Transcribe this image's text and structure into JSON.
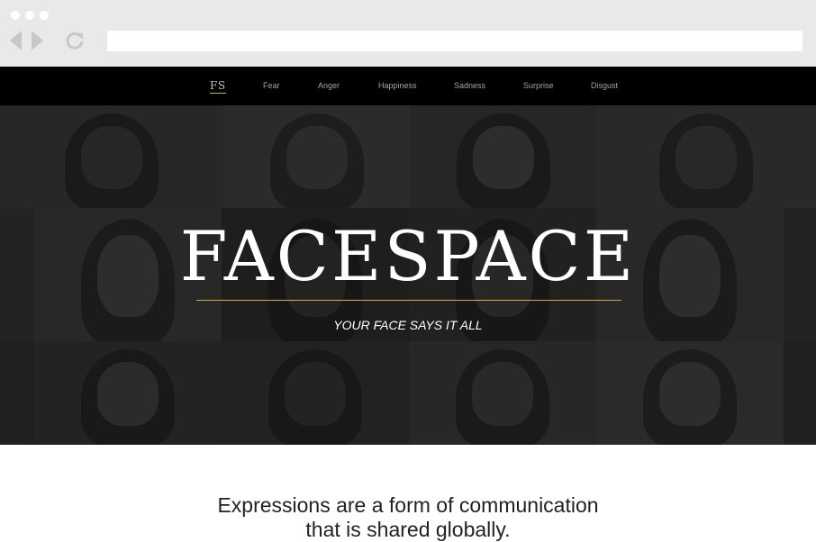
{
  "browser": {
    "window_controls": [
      "close",
      "minimize",
      "maximize"
    ],
    "back_icon": "back-arrow-icon",
    "forward_icon": "forward-arrow-icon",
    "reload_icon": "reload-icon",
    "url": ""
  },
  "nav": {
    "logo": "FS",
    "items": [
      {
        "label": "Fear"
      },
      {
        "label": "Anger"
      },
      {
        "label": "Happiness"
      },
      {
        "label": "Sadness"
      },
      {
        "label": "Surprise"
      },
      {
        "label": "Disgust"
      }
    ]
  },
  "hero": {
    "title": "FACESPACE",
    "tagline": "YOUR FACE SAYS IT ALL"
  },
  "intro": {
    "line1": "Expressions are a form of communication",
    "line2": "that is shared globally."
  },
  "colors": {
    "accent": "#c9b037",
    "nav_bg": "#000000",
    "hero_bg": "#232323"
  }
}
